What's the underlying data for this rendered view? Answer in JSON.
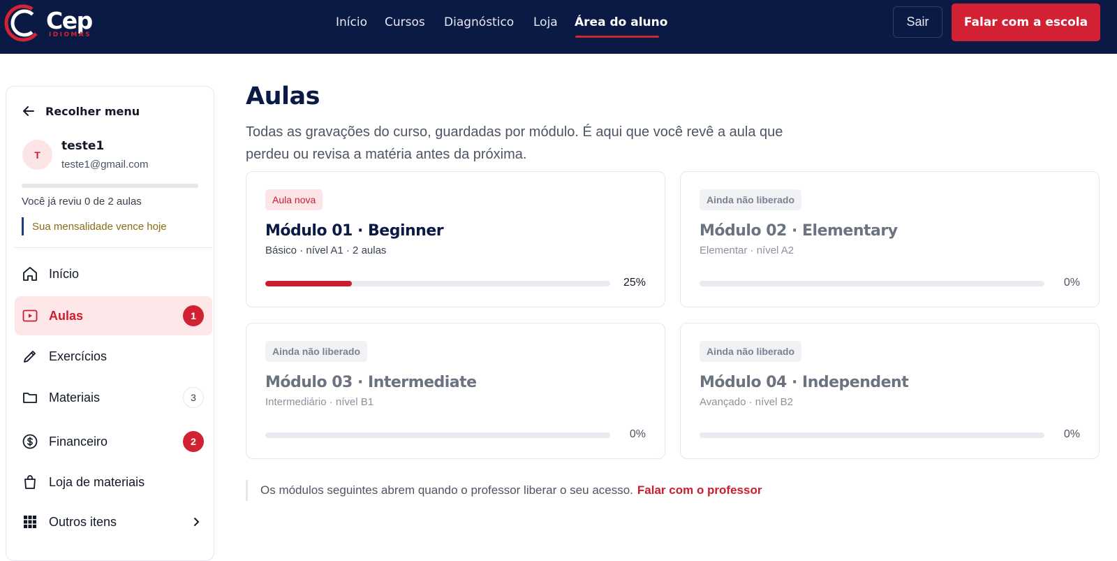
{
  "header": {
    "logo_word": "Cep",
    "logo_sub": "IDIOMAS",
    "nav": [
      "Início",
      "Cursos",
      "Diagnóstico",
      "Loja",
      "Área do aluno"
    ],
    "active_nav": "Área do aluno",
    "logout_label": "Sair",
    "cta_label": "Falar com a escola"
  },
  "sidebar": {
    "collapse_label": "Recolher menu",
    "user": {
      "initial": "T",
      "name": "teste1",
      "email": "teste1@gmail.com"
    },
    "review_text": "Você já reviu 0 de 2 aulas",
    "review_progress": 0,
    "due_note": "Sua mensalidade vence hoje",
    "items": [
      {
        "label": "Início",
        "icon": "home-icon"
      },
      {
        "label": "Aulas",
        "icon": "video-icon",
        "badge": "1",
        "active": true
      },
      {
        "label": "Exercícios",
        "icon": "pencil-icon"
      },
      {
        "label": "Materiais",
        "icon": "folder-icon",
        "badge": "3"
      },
      {
        "label": "Financeiro",
        "icon": "dollar-icon",
        "badge": "2"
      },
      {
        "label": "Loja de materiais",
        "icon": "bag-icon"
      },
      {
        "label": "Outros itens",
        "icon": "grid-icon"
      }
    ]
  },
  "main": {
    "title": "Aulas",
    "description": "Todas as gravações do curso, guardadas por módulo. É aqui que você revê a aula que perdeu ou revisa a matéria antes da próxima.",
    "modules": [
      {
        "tag": "Aula nova",
        "title": "Módulo 01 · Beginner",
        "subtitle": "Básico · nível A1 · 2 aulas",
        "progress": 25,
        "progress_label": "25%",
        "locked": false
      },
      {
        "tag": "Ainda não liberado",
        "title": "Módulo 02 · Elementary",
        "subtitle": "Elementar · nível A2",
        "progress": 0,
        "progress_label": "0%",
        "locked": true
      },
      {
        "tag": "Ainda não liberado",
        "title": "Módulo 03 · Intermediate",
        "subtitle": "Intermediário · nível B1",
        "progress": 0,
        "progress_label": "0%",
        "locked": true
      },
      {
        "tag": "Ainda não liberado",
        "title": "Módulo 04 · Independent",
        "subtitle": "Avançado · nível B2",
        "progress": 0,
        "progress_label": "0%",
        "locked": true
      }
    ],
    "footer_text": "Os módulos seguintes abrem quando o professor liberar o seu acesso.",
    "footer_link": "Falar com o professor"
  },
  "colors": {
    "navy": "#0b1a45",
    "accent_red": "#d12133"
  }
}
